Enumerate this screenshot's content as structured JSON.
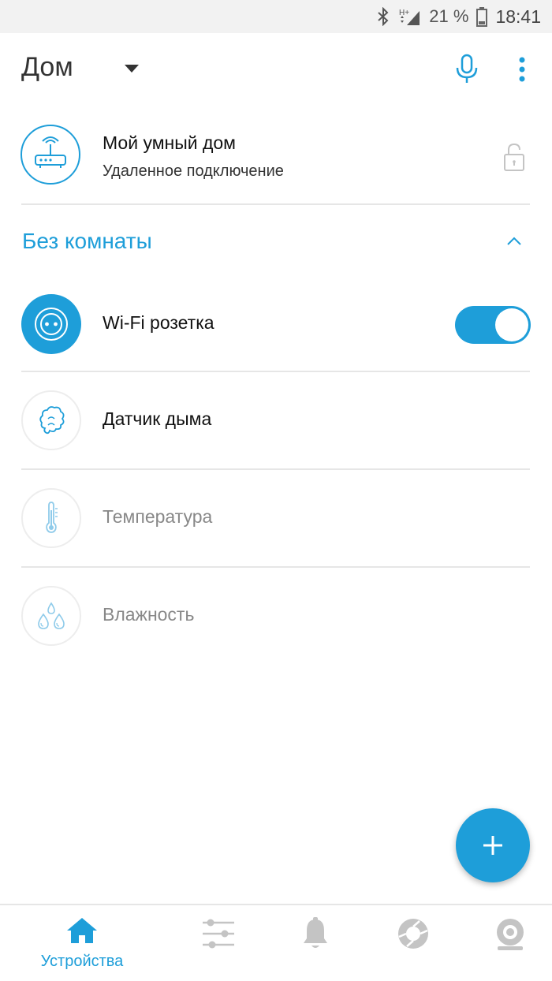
{
  "status_bar": {
    "battery_text": "21 %",
    "time": "18:41",
    "icons": [
      "bluetooth-icon",
      "network-hplus-icon",
      "signal-icon",
      "battery-icon"
    ]
  },
  "app_bar": {
    "title": "Дом",
    "icons": [
      "dropdown-caret-icon",
      "microphone-icon",
      "more-vert-icon"
    ]
  },
  "hub": {
    "name": "Мой умный дом",
    "subtitle": "Удаленное подключение",
    "icons": [
      "router-icon",
      "lock-open-icon"
    ]
  },
  "room": {
    "title": "Без комнаты",
    "icon": "chevron-up-icon"
  },
  "devices": [
    {
      "label": "Wi-Fi розетка",
      "icon": "socket-icon",
      "active": true,
      "toggle_on": true
    },
    {
      "label": "Датчик дыма",
      "icon": "smoke-icon",
      "active": true
    },
    {
      "label": "Температура",
      "icon": "thermometer-icon",
      "active": false
    },
    {
      "label": "Влажность",
      "icon": "humidity-icon",
      "active": false
    }
  ],
  "fab": {
    "label": "+"
  },
  "bottom_nav": {
    "items": [
      {
        "label": "Устройства",
        "icon": "home-icon",
        "active": true
      },
      {
        "label": "",
        "icon": "sliders-icon",
        "active": false
      },
      {
        "label": "",
        "icon": "bell-icon",
        "active": false
      },
      {
        "label": "",
        "icon": "aperture-icon",
        "active": false
      },
      {
        "label": "",
        "icon": "camera-icon",
        "active": false
      }
    ]
  },
  "colors": {
    "accent": "#1e9ed9",
    "muted_icon": "#c4c4c4",
    "divider": "#e6e6e6"
  }
}
